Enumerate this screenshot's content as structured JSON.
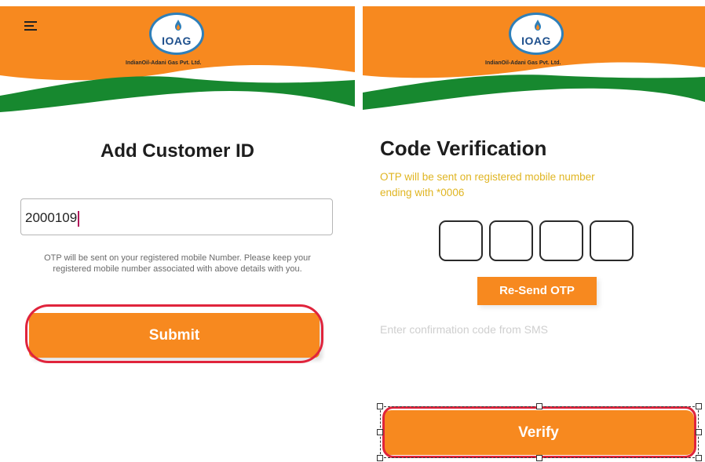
{
  "colors": {
    "brand_orange": "#f7891f",
    "brand_green": "#17882f",
    "accent_red": "#e0243c",
    "otp_notice": "#e0b522"
  },
  "left_screen": {
    "header": {
      "menu_icon": "hamburger-icon",
      "logo_text": "IOAG",
      "company_name": "IndianOil-Adani Gas Pvt. Ltd."
    },
    "title": "Add Customer ID",
    "customer_id_field": {
      "value": "2000109"
    },
    "note": "OTP will be sent on your registered mobile Number. Please keep your registered mobile number associated with above details with you.",
    "submit_label": "Submit"
  },
  "right_screen": {
    "header": {
      "logo_text": "IOAG",
      "company_name": "IndianOil-Adani Gas Pvt. Ltd."
    },
    "title": "Code Verification",
    "otp_notice_line1": "OTP will be sent on registered mobile number",
    "otp_notice_line2": "ending with *0006",
    "otp_digits": [
      "",
      "",
      "",
      ""
    ],
    "resend_label": "Re-Send OTP",
    "sms_hint": "Enter confirmation code from SMS",
    "verify_label": "Verify"
  }
}
